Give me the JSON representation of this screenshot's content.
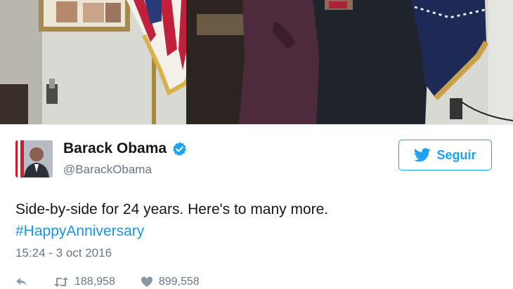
{
  "tweet": {
    "display_name": "Barack Obama",
    "handle": "@BarackObama",
    "follow_label": "Seguir",
    "text_line1": "Side-by-side for 24 years. Here's to many more.",
    "hashtag": "#HappyAnniversary",
    "timestamp": "15:24 - 3 oct 2016",
    "retweet_count": "188,958",
    "like_count": "899,558"
  },
  "colors": {
    "accent": "#1da1f2",
    "link": "#1b95e0",
    "muted": "#657786"
  },
  "icons": [
    "verified-badge-icon",
    "twitter-bird-icon",
    "reply-icon",
    "retweet-icon",
    "heart-icon"
  ]
}
